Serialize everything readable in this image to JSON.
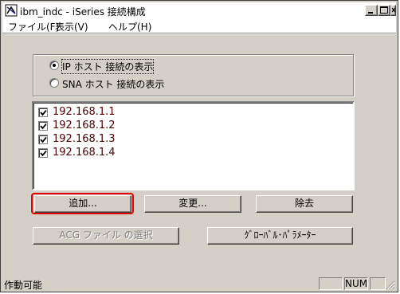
{
  "window": {
    "title": "ibm_indc - iSeries 接続構成"
  },
  "menubar": {
    "items": [
      "ファイル(F)",
      "表示(V)",
      "ヘルプ(H)"
    ]
  },
  "view_options": {
    "ip_label": "IP ホスト 接続の表示",
    "sna_label": "SNA ホスト 接続の表示",
    "selected": "ip"
  },
  "connections": [
    {
      "address": "192.168.1.1",
      "checked": true
    },
    {
      "address": "192.168.1.2",
      "checked": true
    },
    {
      "address": "192.168.1.3",
      "checked": true
    },
    {
      "address": "192.168.1.4",
      "checked": true
    }
  ],
  "buttons": {
    "add": "追加...",
    "change": "変更...",
    "remove": "除去",
    "acg": "ACG ファイル の選択",
    "global": "ｸﾞﾛｰﾊﾞﾙ･ﾊﾟﾗﾒｰﾀｰ"
  },
  "status": {
    "text": "作動可能",
    "num": "NUM"
  },
  "colors": {
    "highlight": "#e30000",
    "face": "#d4d0c8"
  }
}
